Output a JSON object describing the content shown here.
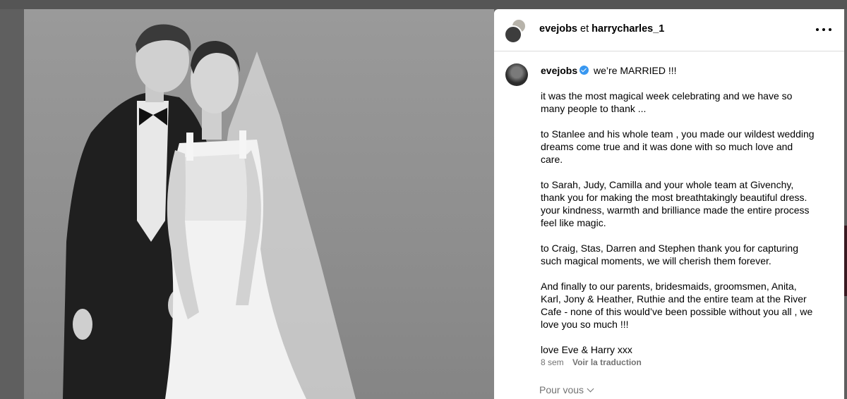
{
  "header": {
    "user1": "evejobs",
    "separator": "et",
    "user2": "harrycharles_1"
  },
  "caption": {
    "username": "evejobs",
    "headline": "we’re MARRIED !!!",
    "paragraphs": [
      "it was the most magical week celebrating and we have so\nmany people to thank ...",
      "to Stanlee and his whole team , you made our wildest wedding\ndreams come true and it was done with so much love and\ncare.",
      "to Sarah, Judy, Camilla and your whole team at Givenchy,\nthank you for making the most breathtakingly beautiful dress.\nyour kindness, warmth and brilliance made the entire process\nfeel like magic.",
      "to Craig, Stas, Darren and Stephen thank you for capturing\nsuch magical moments, we will cherish them forever.",
      "And finally to our parents, bridesmaids, groomsmen, Anita,\nKarl, Jony & Heather, Ruthie and the entire team at the River\nCafe - none of this would’ve been possible without you all , we\nlove you so much !!!",
      "love Eve & Harry xxx"
    ]
  },
  "meta": {
    "time": "8 sem",
    "translate": "Voir la traduction"
  },
  "for_you": "Pour vous",
  "icons": {
    "more": "more-horizontal-icon",
    "verified": "verified-badge-icon",
    "chevron": "chevron-down-icon"
  },
  "colors": {
    "verified": "#3897f0",
    "secondary_text": "#737373"
  }
}
